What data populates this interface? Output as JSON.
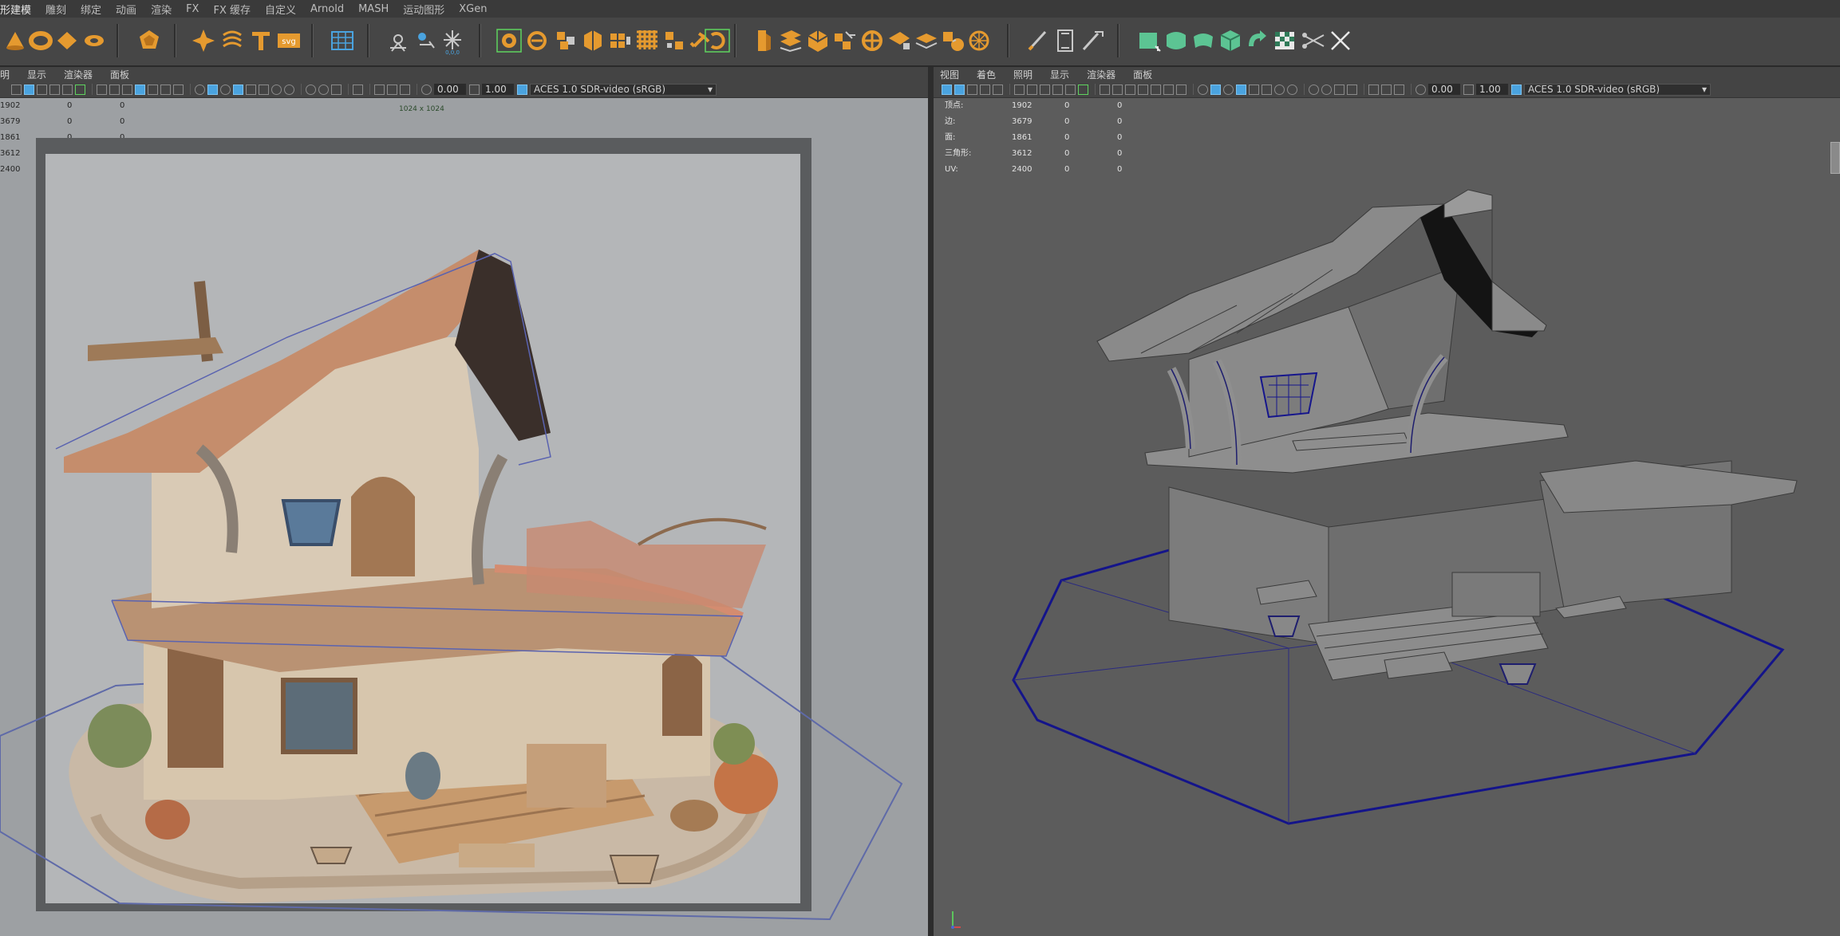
{
  "shelf_tabs": [
    "形建模",
    "雕刻",
    "绑定",
    "动画",
    "渲染",
    "FX",
    "FX 缓存",
    "自定义",
    "Arnold",
    "MASH",
    "运动图形",
    "XGen"
  ],
  "active_tab_index": 0,
  "shelf_icons": [
    {
      "name": "poly-cone-icon",
      "color": "#e59a2f"
    },
    {
      "name": "poly-torus-icon",
      "color": "#e59a2f"
    },
    {
      "name": "poly-plane-icon",
      "color": "#e59a2f"
    },
    {
      "name": "poly-disc-icon",
      "color": "#e59a2f"
    },
    {
      "name": "platonic-solid-icon",
      "color": "#e59a2f"
    },
    {
      "name": "superellipse-icon",
      "color": "#e59a2f"
    },
    {
      "name": "helix-icon",
      "color": "#e59a2f"
    },
    {
      "name": "text-icon",
      "color": "#e59a2f"
    },
    {
      "name": "svg-icon",
      "color": "#e59a2f"
    },
    {
      "name": "uv-layout-icon",
      "color": "#4aa3df"
    },
    {
      "name": "pivot-icon",
      "color": "#c8c8c8"
    },
    {
      "name": "center-pivot-icon",
      "color": "#c8c8c8"
    },
    {
      "name": "reset-transform-icon",
      "color": "#c8c8c8"
    },
    {
      "name": "make-live-icon",
      "color": "#e59a2f"
    },
    {
      "name": "combine-icon",
      "color": "#e59a2f"
    },
    {
      "name": "separate-icon",
      "color": "#e59a2f"
    },
    {
      "name": "extract-icon",
      "color": "#e59a2f"
    },
    {
      "name": "smooth-icon",
      "color": "#e59a2f"
    },
    {
      "name": "boolean-icon",
      "color": "#e59a2f"
    },
    {
      "name": "mirror-icon",
      "color": "#e59a2f"
    },
    {
      "name": "remesh-icon",
      "color": "#e59a2f"
    },
    {
      "name": "retopo-icon",
      "color": "#e59a2f"
    },
    {
      "name": "extrude-icon",
      "color": "#e59a2f"
    },
    {
      "name": "bridge-icon",
      "color": "#e59a2f"
    },
    {
      "name": "bevel-icon",
      "color": "#e59a2f"
    },
    {
      "name": "fill-hole-icon",
      "color": "#e59a2f"
    },
    {
      "name": "append-polygon-icon",
      "color": "#e59a2f"
    },
    {
      "name": "multi-cut-icon",
      "color": "#c8c8c8"
    },
    {
      "name": "insert-edge-loop-icon",
      "color": "#c8c8c8"
    },
    {
      "name": "target-weld-icon",
      "color": "#c8c8c8"
    },
    {
      "name": "uv-planar-icon",
      "color": "#5cc493"
    },
    {
      "name": "uv-cylindrical-icon",
      "color": "#5cc493"
    },
    {
      "name": "uv-spherical-icon",
      "color": "#5cc493"
    },
    {
      "name": "uv-auto-icon",
      "color": "#5cc493"
    },
    {
      "name": "uv-unfold-icon",
      "color": "#5cc493"
    },
    {
      "name": "uv-checker-icon",
      "color": "#5cc493"
    },
    {
      "name": "uv-cut-icon",
      "color": "#c8c8c8"
    },
    {
      "name": "uv-sew-icon",
      "color": "#c8c8c8"
    }
  ],
  "left_panel": {
    "menus": [
      "明",
      "显示",
      "渲染器",
      "面板"
    ],
    "field_1": "0.00",
    "field_2": "1.00",
    "color_space": "ACES 1.0 SDR-video (sRGB)",
    "resolution_label": "1024 x 1024",
    "hud_values": [
      [
        "1902",
        "0",
        "0"
      ],
      [
        "3679",
        "0",
        "0"
      ],
      [
        "1861",
        "0",
        "0"
      ],
      [
        "3612",
        "0",
        "0"
      ],
      [
        "2400",
        "0",
        "0"
      ]
    ]
  },
  "right_panel": {
    "menus": [
      "视图",
      "着色",
      "照明",
      "显示",
      "渲染器",
      "面板"
    ],
    "field_1": "0.00",
    "field_2": "1.00",
    "color_space": "ACES 1.0 SDR-video (sRGB)",
    "hud": [
      {
        "label": "顶点:",
        "v1": "1902",
        "v2": "0",
        "v3": "0"
      },
      {
        "label": "边:",
        "v1": "3679",
        "v2": "0",
        "v3": "0"
      },
      {
        "label": "面:",
        "v1": "1861",
        "v2": "0",
        "v3": "0"
      },
      {
        "label": "三角形:",
        "v1": "3612",
        "v2": "0",
        "v3": "0"
      },
      {
        "label": "UV:",
        "v1": "2400",
        "v2": "0",
        "v3": "0"
      }
    ]
  },
  "colors": {
    "accent_orange": "#e59a2f",
    "accent_blue": "#4aa3df",
    "accent_green": "#5cc493",
    "wire_blue": "#1a1a8a"
  }
}
